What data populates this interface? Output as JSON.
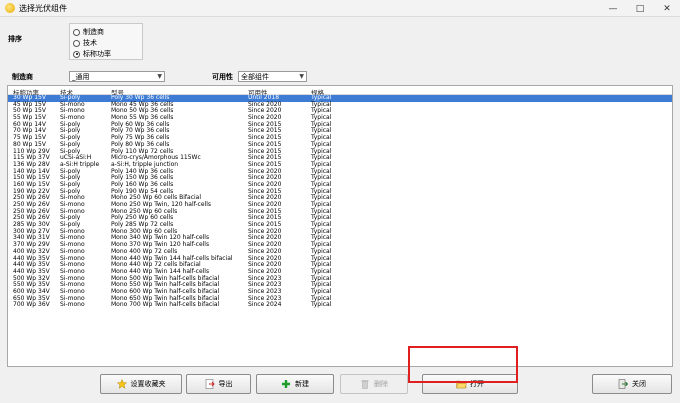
{
  "window": {
    "title": "选择光伏组件"
  },
  "sort": {
    "label": "排序",
    "options": [
      "制造商",
      "技术",
      "标称功率"
    ],
    "selected_index": 2
  },
  "filters": {
    "manufacturer_label": "制造商",
    "manufacturer_value": "_通用",
    "availability_label": "可用性",
    "availability_value": "全部组件"
  },
  "table": {
    "headers": [
      "标称功率",
      "技术",
      "型号",
      "可用性",
      "规格"
    ],
    "selected_row": 0,
    "rows": [
      [
        "30 Wp 15V",
        "Si-poly",
        "Poly 30 Wp 36 cells",
        "Until 2018",
        "Typical"
      ],
      [
        "45 Wp 15V",
        "Si-mono",
        "Mono 45 Wp 36 cells",
        "Since 2020",
        "Typical"
      ],
      [
        "50 Wp 15V",
        "Si-mono",
        "Mono 50 Wp 36 cells",
        "Since 2020",
        "Typical"
      ],
      [
        "55 Wp 15V",
        "Si-mono",
        "Mono 55 Wp 36 cells",
        "Since 2020",
        "Typical"
      ],
      [
        "60 Wp 14V",
        "Si-poly",
        "Poly 60 Wp  36 cells",
        "Since 2015",
        "Typical"
      ],
      [
        "70 Wp 14V",
        "Si-poly",
        "Poly 70 Wp 36 cells",
        "Since 2015",
        "Typical"
      ],
      [
        "75 Wp 15V",
        "Si-poly",
        "Poly 75 Wp 36 cells",
        "Since 2015",
        "Typical"
      ],
      [
        "80 Wp 15V",
        "Si-poly",
        "Poly 80 Wp 36 cells",
        "Since 2015",
        "Typical"
      ],
      [
        "110 Wp 29V",
        "Si-poly",
        "Poly 110 Wp  72 cells",
        "Since 2015",
        "Typical"
      ],
      [
        "115 Wp 37V",
        "uCSi-aSi:H",
        "Micro-crys/Amorphous 115Wc",
        "Since 2015",
        "Typical"
      ],
      [
        "136 Wp 28V",
        "a-Si:H tripple",
        "a-Si:H, tripple junction",
        "Since 2015",
        "Typical"
      ],
      [
        "140 Wp 14V",
        "Si-poly",
        "Poly 140 Wp 36 cells",
        "Since 2020",
        "Typical"
      ],
      [
        "150 Wp 15V",
        "Si-poly",
        "Poly 150 Wp 36 cells",
        "Since 2020",
        "Typical"
      ],
      [
        "160 Wp 15V",
        "Si-poly",
        "Poly 160 Wp 36 cells",
        "Since 2020",
        "Typical"
      ],
      [
        "190 Wp 22V",
        "Si-poly",
        "Poly 190 Wp  54 cells",
        "Since 2015",
        "Typical"
      ],
      [
        "250 Wp 26V",
        "Si-mono",
        "Mono 250 Wp  60 cells Bifacial",
        "Since 2020",
        "Typical"
      ],
      [
        "250 Wp 26V",
        "Si-mono",
        "Mono 250 Wp  Twin, 120 half-cells",
        "Since 2020",
        "Typical"
      ],
      [
        "250 Wp 26V",
        "Si-mono",
        "Mono 250 Wp  60 cells",
        "Since 2015",
        "Typical"
      ],
      [
        "250 Wp 26V",
        "Si-poly",
        "Poly 250 Wp  60 cells",
        "Since 2015",
        "Typical"
      ],
      [
        "285 Wp 30V",
        "Si-poly",
        "Poly 285 Wp  72 cells",
        "Since 2015",
        "Typical"
      ],
      [
        "300 Wp 27V",
        "Si-mono",
        "Mono 300 Wp 60 cells",
        "Since 2020",
        "Typical"
      ],
      [
        "340 Wp 31V",
        "Si-mono",
        "Mono 340 Wp Twin 120 half-cells",
        "Since 2020",
        "Typical"
      ],
      [
        "370 Wp 29V",
        "Si-mono",
        "Mono 370 Wp Twin 120 half-cells",
        "Since 2020",
        "Typical"
      ],
      [
        "400 Wp 32V",
        "Si-mono",
        "Mono 400 Wp 72 cells",
        "Since 2020",
        "Typical"
      ],
      [
        "440 Wp 35V",
        "Si-mono",
        "Mono 440 Wp Twin 144 half-cells bifacial",
        "Since 2020",
        "Typical"
      ],
      [
        "440 Wp 35V",
        "Si-mono",
        "Mono 440 Wp 72 cells bifacial",
        "Since 2020",
        "Typical"
      ],
      [
        "440 Wp 35V",
        "Si-mono",
        "Mono 440 Wp Twin 144 half-cells",
        "Since 2020",
        "Typical"
      ],
      [
        "500 Wp 32V",
        "Si-mono",
        "Mono 500 Wp Twin half-cells bifacial",
        "Since 2023",
        "Typical"
      ],
      [
        "550 Wp 35V",
        "Si-mono",
        "Mono 550 Wp Twin half-cells bifacial",
        "Since 2023",
        "Typical"
      ],
      [
        "600 Wp 34V",
        "Si-mono",
        "Mono 600 Wp Twin half-cells bifacial",
        "Since 2023",
        "Typical"
      ],
      [
        "650 Wp 35V",
        "Si-mono",
        "Mono 650 Wp Twin half-cells bifacial",
        "Since 2023",
        "Typical"
      ],
      [
        "700 Wp 36V",
        "Si-mono",
        "Mono 700 Wp Twin half-cells bifacial",
        "Since 2024",
        "Typical"
      ]
    ]
  },
  "buttons": {
    "favorites": "设置收藏夹",
    "export": "导出",
    "new": "新建",
    "delete": "删除",
    "open": "打开",
    "close": "关闭"
  },
  "colors": {
    "selection": "#3d7bd5",
    "highlight_box": "#e02020"
  }
}
